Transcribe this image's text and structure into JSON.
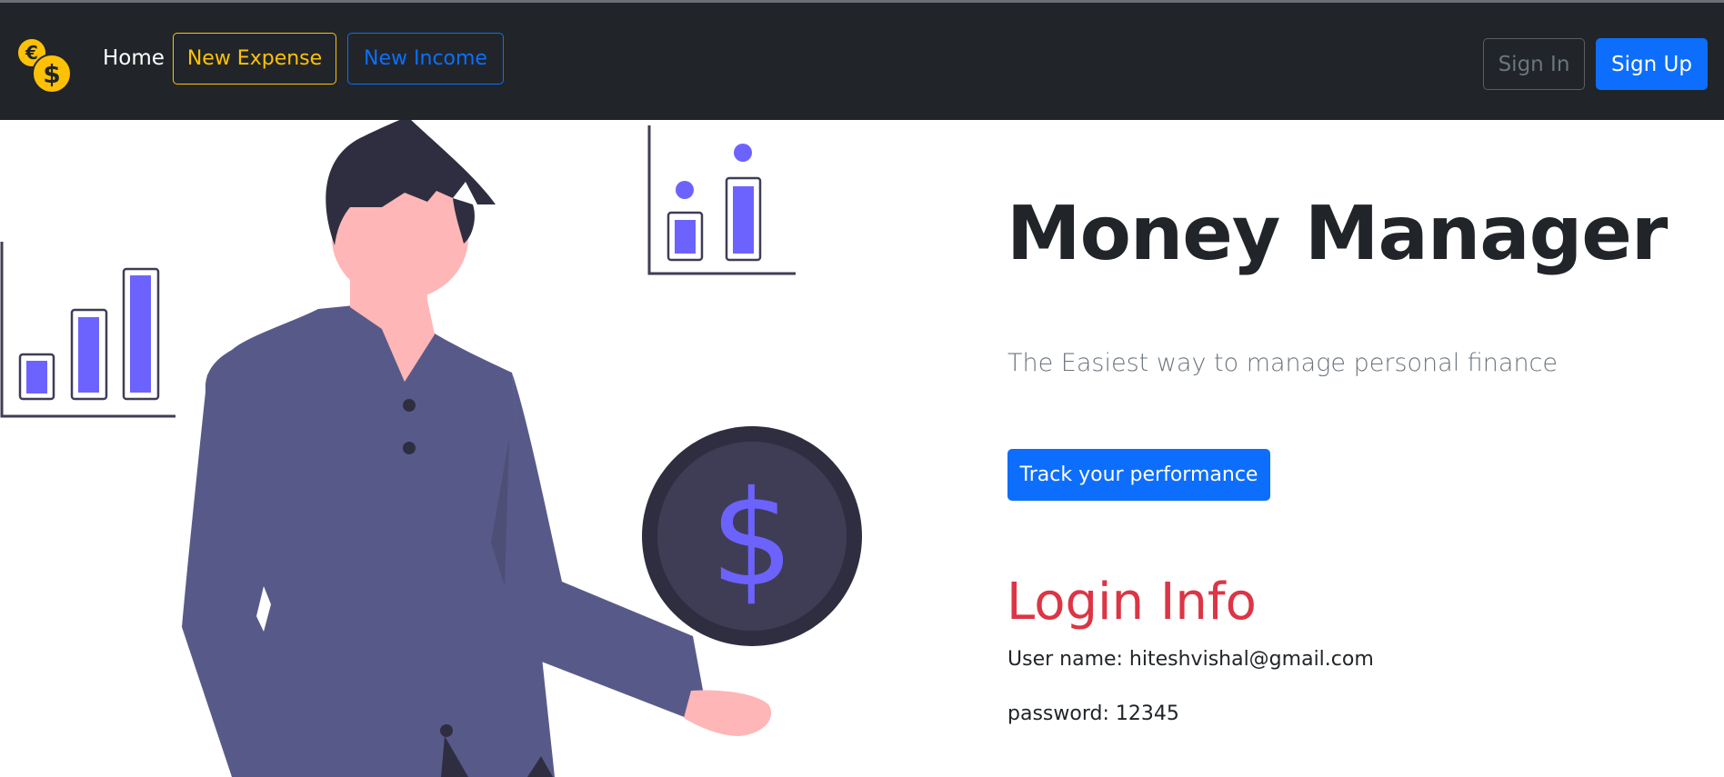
{
  "navbar": {
    "logo_icon": "coins-logo-icon",
    "home_label": "Home",
    "new_expense_label": "New Expense",
    "new_income_label": "New Income",
    "sign_in_label": "Sign In",
    "sign_up_label": "Sign Up"
  },
  "hero": {
    "title": "Money Manager",
    "lead": "The Easiest way to manage personal finance",
    "cta_label": "Track your performance"
  },
  "login_info": {
    "title": "Login Info",
    "user_line": "User name: hiteshvishal@gmail.com",
    "password_line": "password: 12345"
  },
  "illustration": {
    "coin_symbol": "$"
  },
  "colors": {
    "navbar_bg": "#212529",
    "primary": "#0d6efd",
    "warning": "#ffc107",
    "danger": "#dc3545",
    "muted": "#6c757d",
    "accent_purple": "#6c63ff"
  }
}
